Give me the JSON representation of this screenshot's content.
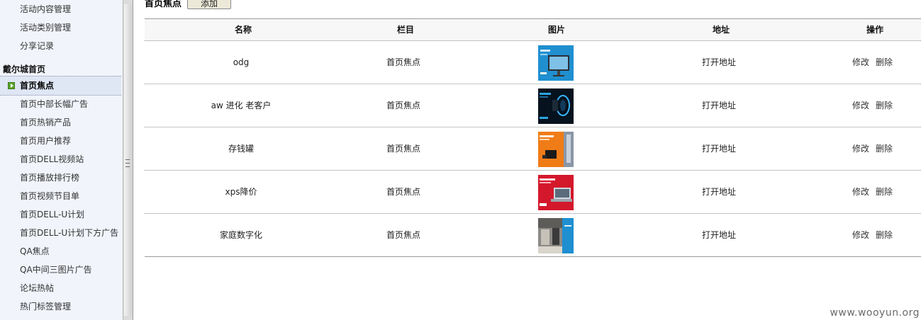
{
  "sidebar": {
    "items_top": [
      "活动内容管理",
      "活动类别管理",
      "分享记录"
    ],
    "group_title": "戴尔城首页",
    "active_item": "首页焦点",
    "items_bottom": [
      "首页中部长幅广告",
      "首页热销产品",
      "首页用户推荐",
      "首页DELL视频站",
      "首页播放排行榜",
      "首页视频节目单",
      "首页DELL-U计划",
      "首页DELL-U计划下方广告",
      "QA焦点",
      "QA中间三图片广告",
      "论坛热帖",
      "热门标签管理"
    ]
  },
  "header": {
    "title": "首页焦点",
    "add_label": "添加"
  },
  "table": {
    "columns": [
      "名称",
      "栏目",
      "图片",
      "地址",
      "操作"
    ],
    "rows": [
      {
        "name": "odg",
        "category": "首页焦点",
        "link": "打开地址",
        "thumb": "monitor-blue"
      },
      {
        "name": "aw 进化 老客户",
        "category": "首页焦点",
        "link": "打开地址",
        "thumb": "dark-blue-glow"
      },
      {
        "name": "存钱罐",
        "category": "首页焦点",
        "link": "打开地址",
        "thumb": "orange-box"
      },
      {
        "name": "xps降价",
        "category": "首页焦点",
        "link": "打开地址",
        "thumb": "red-laptop"
      },
      {
        "name": "家庭数字化",
        "category": "首页焦点",
        "link": "打开地址",
        "thumb": "grey-photo"
      }
    ],
    "edit_label": "修改",
    "delete_label": "删除"
  },
  "watermark": "www.wooyun.org"
}
